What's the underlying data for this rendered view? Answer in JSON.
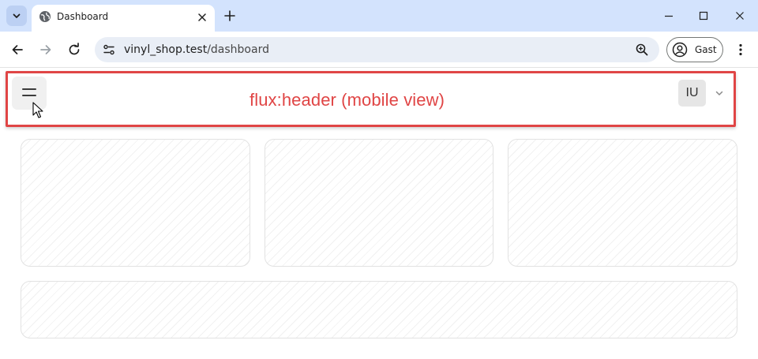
{
  "browser": {
    "tab": {
      "title": "Dashboard",
      "favicon": "globe-icon"
    },
    "omnibox": {
      "url_host": "vinyl_shop.test",
      "url_path": "/dashboard"
    },
    "profile": {
      "name": "Gast"
    }
  },
  "app": {
    "header_label": "flux:header (mobile view)",
    "user_initials": "IU",
    "accent_color": "#e04545"
  }
}
